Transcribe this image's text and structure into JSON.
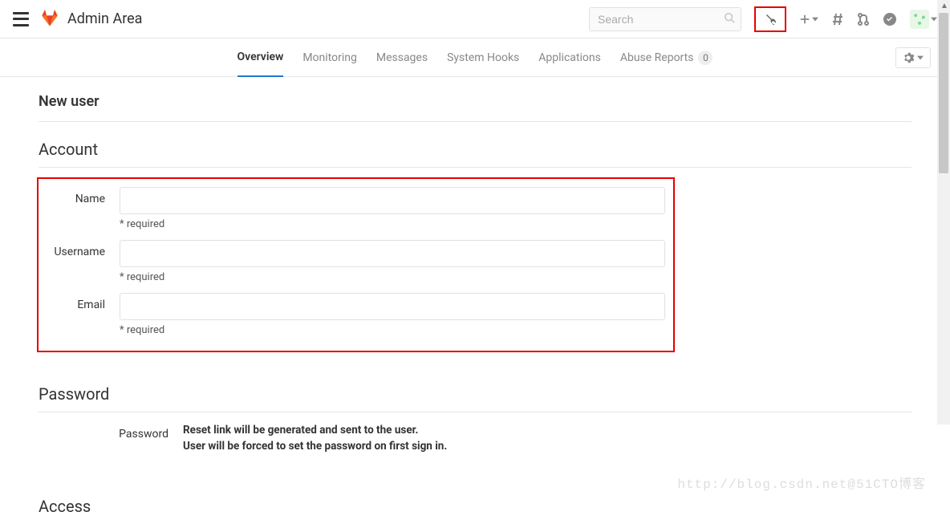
{
  "header": {
    "title": "Admin Area",
    "search_placeholder": "Search"
  },
  "subnav": {
    "items": [
      {
        "label": "Overview",
        "active": true
      },
      {
        "label": "Monitoring"
      },
      {
        "label": "Messages"
      },
      {
        "label": "System Hooks"
      },
      {
        "label": "Applications"
      },
      {
        "label": "Abuse Reports",
        "badge": "0"
      }
    ]
  },
  "page": {
    "title": "New user",
    "sections": {
      "account": {
        "heading": "Account",
        "fields": {
          "name": {
            "label": "Name",
            "value": "",
            "help": "* required"
          },
          "username": {
            "label": "Username",
            "value": "",
            "help": "* required"
          },
          "email": {
            "label": "Email",
            "value": "",
            "help": "* required"
          }
        }
      },
      "password": {
        "heading": "Password",
        "field_label": "Password",
        "info_line1": "Reset link will be generated and sent to the user.",
        "info_line2": "User will be forced to set the password on first sign in."
      },
      "access": {
        "heading": "Access"
      }
    }
  },
  "watermark": "http://blog.csdn.net@51CTO博客"
}
